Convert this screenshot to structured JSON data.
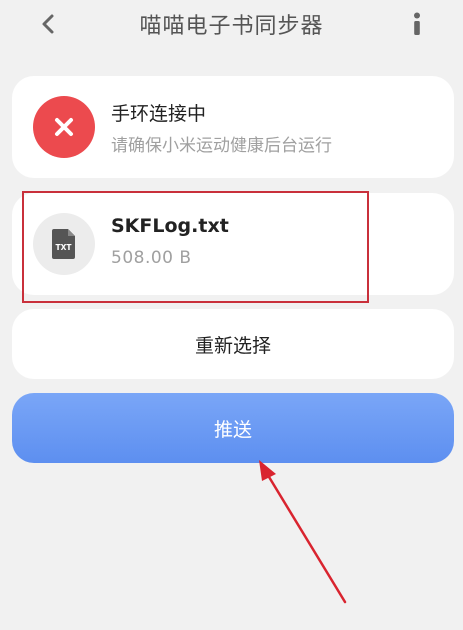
{
  "header": {
    "title": "喵喵电子书同步器",
    "back_icon": "chevron-left-icon",
    "info_icon": "info-icon"
  },
  "connection_card": {
    "status_icon": "error-x-icon",
    "status_color": "#ec4a4e",
    "title": "手环连接中",
    "subtitle": "请确保小米运动健康后台运行"
  },
  "file_card": {
    "file_icon": "txt-file-icon",
    "badge_text": "TXT",
    "file_name": "SKFLog.txt",
    "file_size": "508.00 B"
  },
  "reselect_button": {
    "label": "重新选择"
  },
  "push_button": {
    "label": "推送",
    "color": "#6a9af3"
  },
  "annotations": {
    "color": "#d9242f"
  }
}
